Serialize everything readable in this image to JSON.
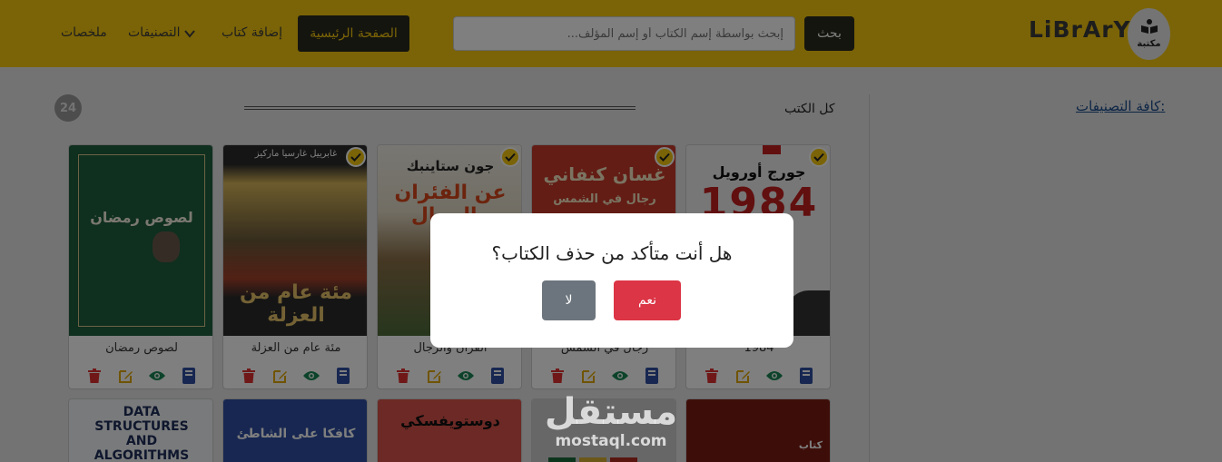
{
  "navbar": {
    "logo_label": "مكتبة",
    "brand": "LiBrArY",
    "search_button": "بحث",
    "search_placeholder": "إبحث بواسطة إسم الكتاب أو إسم المؤلف...",
    "home": "الصفحة الرئيسية",
    "add_book": "إضافة كتاب",
    "categories": "التصنيفات",
    "summaries": "ملخصات",
    "accent_color": "#f6c90e"
  },
  "sidebar": {
    "all_categories": "كافة التصنيفات:"
  },
  "main": {
    "section_title": "كل الكتب",
    "count": "24"
  },
  "books": [
    {
      "title": "1984",
      "cover_author": "جورج أورويل",
      "cover_title": "1984"
    },
    {
      "title": "رجال في الشمس",
      "cover_author": "غسان كنفاني",
      "cover_title": "رجال في الشمس"
    },
    {
      "title": "القران والرجال",
      "cover_author": "جون ستاينبك",
      "cover_title": "عن الفئران والرجال"
    },
    {
      "title": "مئة عام من العزلة",
      "cover_author": "غابرييل غارسيا ماركيز",
      "cover_title": "مئة عام من العزلة"
    },
    {
      "title": "لصوص رمضان",
      "cover_author": "",
      "cover_title": "لصوص رمضان"
    }
  ],
  "books_row2": [
    {
      "cover_title": "كتاب"
    },
    {
      "cover_title": "مستقل"
    },
    {
      "cover_title": "دوستويفسكي"
    },
    {
      "cover_title": "كافكا على الشاطئ"
    },
    {
      "cover_title": "DATA STRUCTURES AND ALGORITHMS"
    }
  ],
  "modal": {
    "question": "هل أنت متأكد من حذف الكتاب؟",
    "yes": "نعم",
    "no": "لا"
  },
  "watermark": {
    "arabic": "مستقل",
    "latin": "mostaql.com"
  },
  "icons": [
    "book-icon",
    "eye-icon",
    "edit-icon",
    "trash-icon",
    "check-icon",
    "chevron-down-icon"
  ]
}
